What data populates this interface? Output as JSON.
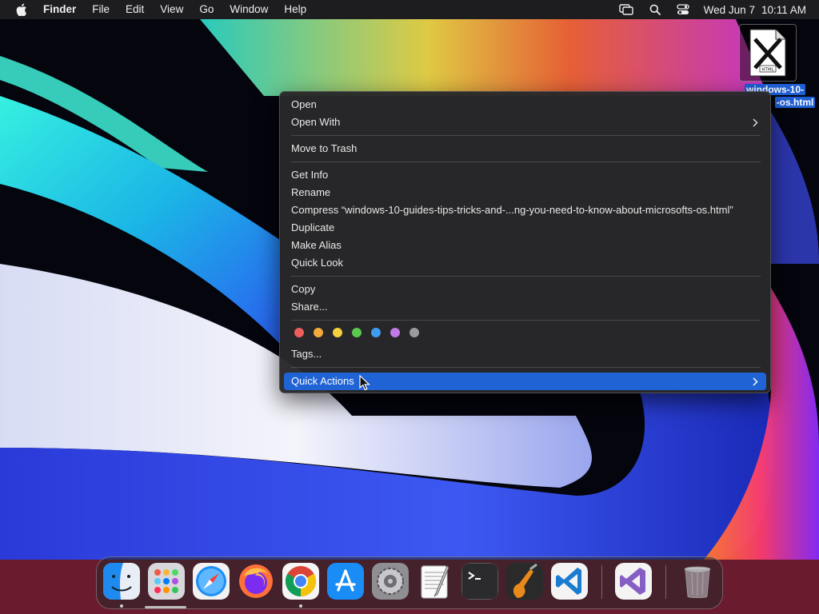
{
  "menubar": {
    "app_name": "Finder",
    "menus": [
      "File",
      "Edit",
      "View",
      "Go",
      "Window",
      "Help"
    ],
    "date": "Wed Jun 7",
    "time": "10:11 AM",
    "status_icons": [
      "screen-mirroring-icon",
      "spotlight-search-icon",
      "control-center-icon"
    ]
  },
  "desktop_file": {
    "thumb_text": "HTML",
    "label_line1": "windows-10-",
    "label_line2": "-os.html"
  },
  "context_menu": {
    "open": "Open",
    "open_with": "Open With",
    "move_to_trash": "Move to Trash",
    "get_info": "Get Info",
    "rename": "Rename",
    "compress": "Compress “windows-10-guides-tips-tricks-and-...ng-you-need-to-know-about-microsofts-os.html”",
    "duplicate": "Duplicate",
    "make_alias": "Make Alias",
    "quick_look": "Quick Look",
    "copy": "Copy",
    "share": "Share...",
    "tags": "Tags...",
    "quick_actions": "Quick Actions",
    "tag_colors": [
      "#ec5e5b",
      "#f3a93b",
      "#f4d03f",
      "#5bc84f",
      "#3f9cf0",
      "#c279e6",
      "#9c9c9c"
    ],
    "highlight_color": "#1f63d4"
  },
  "dock": {
    "apps": [
      "finder",
      "launchpad",
      "safari",
      "firefox",
      "chrome",
      "app-store",
      "system-preferences",
      "textedit",
      "terminal",
      "garageband",
      "vscode",
      "visual-studio",
      "trash"
    ]
  }
}
